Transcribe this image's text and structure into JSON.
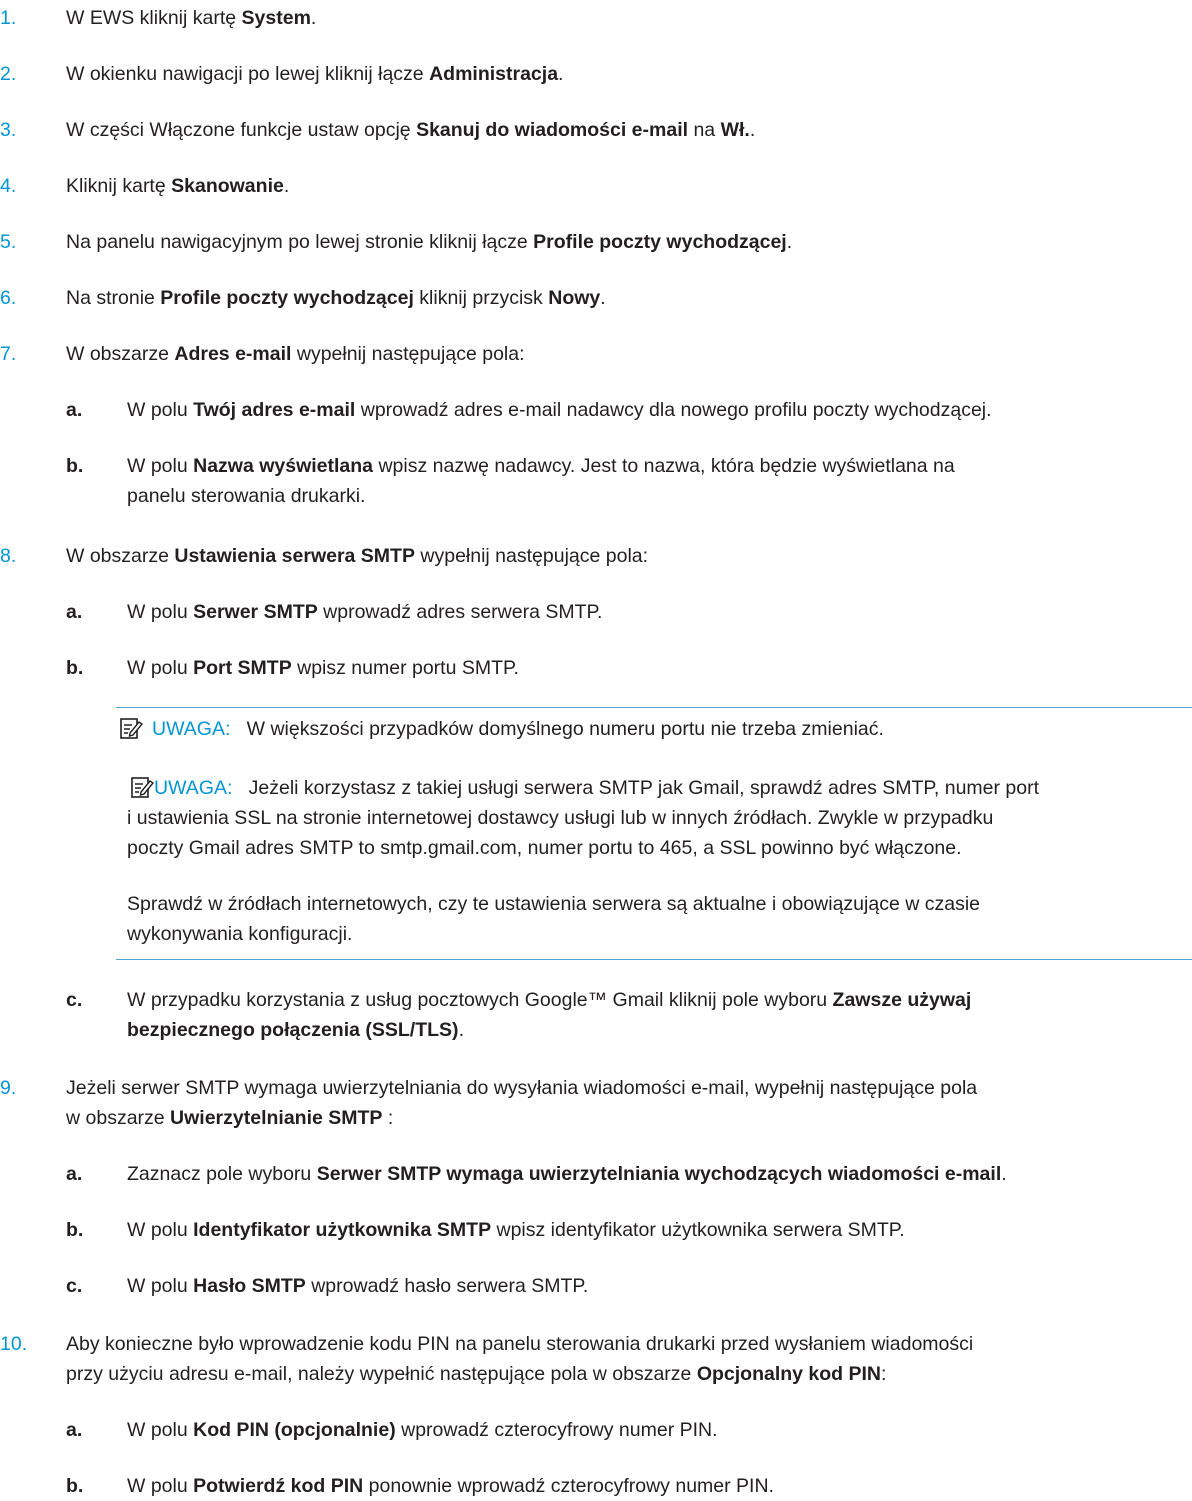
{
  "steps": [
    {
      "num": "1.",
      "parts": [
        "W EWS kliknij kartę ",
        "System",
        "."
      ]
    },
    {
      "num": "2.",
      "parts": [
        "W okienku nawigacji po lewej kliknij łącze ",
        "Administracja",
        "."
      ]
    },
    {
      "num": "3.",
      "parts": [
        "W części Włączone funkcje ustaw opcję ",
        "Skanuj do wiadomości e-mail",
        " na ",
        "Wł.",
        "."
      ]
    },
    {
      "num": "4.",
      "parts": [
        "Kliknij kartę ",
        "Skanowanie",
        "."
      ]
    },
    {
      "num": "5.",
      "parts": [
        "Na panelu nawigacyjnym po lewej stronie kliknij łącze ",
        "Profile poczty wychodzącej",
        "."
      ]
    },
    {
      "num": "6.",
      "parts": [
        "Na stronie ",
        "Profile poczty wychodzącej",
        " kliknij przycisk ",
        "Nowy",
        "."
      ]
    },
    {
      "num": "7.",
      "parts": [
        "W obszarze ",
        "Adres e-mail",
        " wypełnij następujące pola:"
      ],
      "subs": [
        {
          "letter": "a.",
          "parts": [
            "W polu ",
            "Twój adres e-mail",
            " wprowadź adres e-mail nadawcy dla nowego profilu poczty wychodzącej."
          ]
        },
        {
          "letter": "b.",
          "parts": [
            "W polu ",
            "Nazwa wyświetlana",
            " wpisz nazwę nadawcy. Jest to nazwa, która będzie wyświetlana na"
          ],
          "cont": "panelu sterowania drukarki."
        }
      ]
    },
    {
      "num": "8.",
      "parts": [
        "W obszarze ",
        "Ustawienia serwera SMTP",
        " wypełnij następujące pola:"
      ],
      "subs": [
        {
          "letter": "a.",
          "parts": [
            "W polu ",
            "Serwer SMTP",
            " wprowadź adres serwera SMTP."
          ]
        },
        {
          "letter": "b.",
          "parts": [
            "W polu ",
            "Port SMTP",
            " wpisz numer portu SMTP."
          ]
        },
        {
          "letter": "c.",
          "parts": [
            "W przypadku korzystania z usług pocztowych Google™ Gmail kliknij pole wyboru ",
            "Zawsze używaj"
          ],
          "cont": "bezpiecznego połączenia (SSL/TLS)",
          "cont_tail": "."
        }
      ]
    },
    {
      "num": "9.",
      "parts": [
        "Jeżeli serwer SMTP wymaga uwierzytelniania do wysyłania wiadomości e-mail, wypełnij następujące pola"
      ],
      "cont": [
        "w obszarze ",
        "Uwierzytelnianie SMTP",
        " :"
      ],
      "subs": [
        {
          "letter": "a.",
          "parts": [
            "Zaznacz pole wyboru ",
            "Serwer SMTP wymaga uwierzytelniania wychodzących wiadomości e-mail",
            "."
          ]
        },
        {
          "letter": "b.",
          "parts": [
            "W polu ",
            "Identyfikator użytkownika SMTP",
            " wpisz identyfikator użytkownika serwera SMTP."
          ]
        },
        {
          "letter": "c.",
          "parts": [
            "W polu ",
            "Hasło SMTP",
            " wprowadź hasło serwera SMTP."
          ]
        }
      ]
    },
    {
      "num": "10.",
      "parts": [
        "Aby konieczne było wprowadzenie kodu PIN na panelu sterowania drukarki przed wysłaniem wiadomości"
      ],
      "cont": [
        "przy użyciu adresu e-mail, należy wypełnić następujące pola w obszarze ",
        "Opcjonalny kod PIN",
        ":"
      ],
      "subs": [
        {
          "letter": "a.",
          "parts": [
            "W polu ",
            "Kod PIN (opcjonalnie)",
            " wprowadź czterocyfrowy numer PIN."
          ]
        },
        {
          "letter": "b.",
          "parts": [
            "W polu ",
            "Potwierdź kod PIN",
            " ponownie wprowadź czterocyfrowy numer PIN."
          ]
        }
      ]
    }
  ],
  "notes": {
    "label": "UWAGA:",
    "note1": "W większości przypadków domyślnego numeru portu nie trzeba zmieniać.",
    "note2_lines": [
      "Jeżeli korzystasz z takiej usługi serwera SMTP jak Gmail, sprawdź adres SMTP, numer port",
      "i ustawienia SSL na stronie internetowej dostawcy usługi lub w innych źródłach. Zwykle w przypadku",
      "poczty Gmail adres SMTP to smtp.gmail.com, numer portu to 465, a SSL powinno być włączone."
    ],
    "note2_para2": [
      "Sprawdź w źródłach internetowych, czy te ustawienia serwera są aktualne i obowiązujące w czasie",
      "wykonywania konfiguracji."
    ]
  },
  "colors": {
    "accent": "#0096d6",
    "text": "#231f20",
    "rule": "#4fa3d9"
  }
}
